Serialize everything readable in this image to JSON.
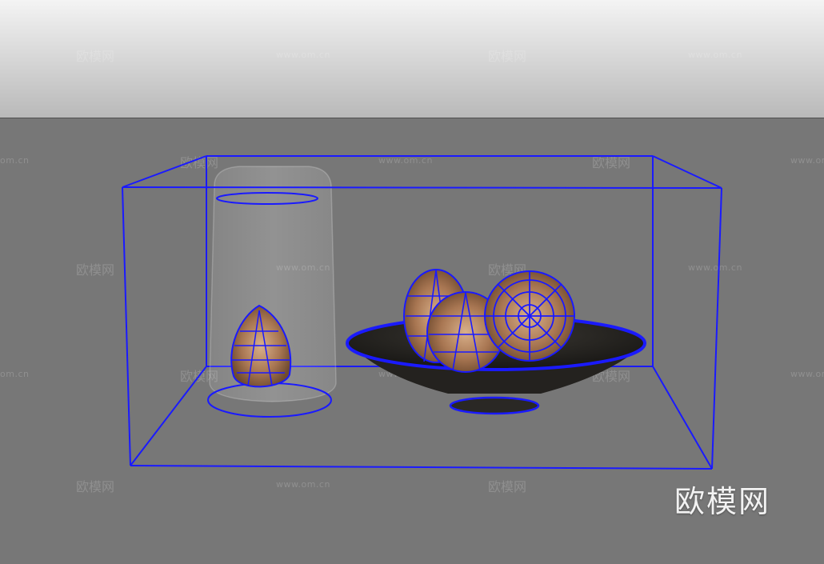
{
  "watermarks": {
    "brand": "欧模网",
    "url": "www.om.cn",
    "url_partial": "om.cn"
  },
  "scene": {
    "objects": [
      "bounding-box",
      "glass-jar",
      "small-pine-cone",
      "bowl",
      "large-pine-cones"
    ],
    "colors": {
      "wireframe": "#1a1aff",
      "backdrop_top": "#f4f4f4",
      "backdrop_bottom": "#b9b9b9",
      "floor": "#777777",
      "bowl": "#2b2926",
      "cone": "#b98a66"
    }
  }
}
